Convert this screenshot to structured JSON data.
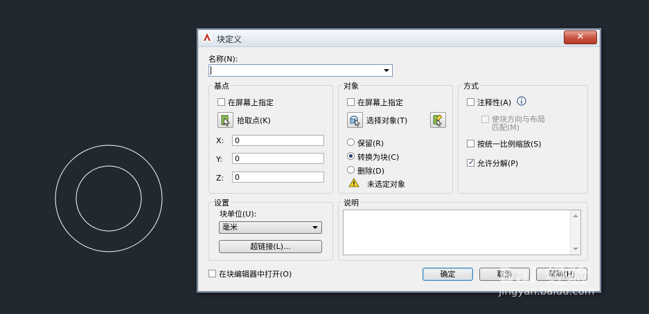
{
  "drawing": {
    "stroke_color": "#ffffff",
    "background": "#212830"
  },
  "dialog": {
    "title": "块定义",
    "close_label": "✕",
    "name_label": "名称(N):",
    "name_value": "",
    "basepoint": {
      "group_title": "基点",
      "specify_on_screen": "在屏幕上指定",
      "pick_point": "拾取点(K)",
      "x_label": "X:",
      "x_value": "0",
      "y_label": "Y:",
      "y_value": "0",
      "z_label": "Z:",
      "z_value": "0"
    },
    "objects": {
      "group_title": "对象",
      "specify_on_screen": "在屏幕上指定",
      "select_objects": "选择对象(T)",
      "retain": "保留(R)",
      "convert_to_block": "转换为块(C)",
      "delete": "删除(D)",
      "selected_convert": true,
      "status": "未选定对象"
    },
    "behavior": {
      "group_title": "方式",
      "annotative": "注释性(A)",
      "match_orientation_line1": "使块方向与布局",
      "match_orientation_line2": "匹配(M)",
      "scale_uniformly": "按统一比例缩放(S)",
      "allow_exploding": "允许分解(P)",
      "allow_exploding_checked": true
    },
    "settings": {
      "group_title": "设置",
      "block_unit_label": "块单位(U):",
      "block_unit_value": "毫米",
      "hyperlink_label": "超链接(L)..."
    },
    "description": {
      "group_title": "说明",
      "value": ""
    },
    "open_in_editor": "在块编辑器中打开(O)",
    "buttons": {
      "ok": "确定",
      "cancel": "取消",
      "help": "帮助(H)"
    }
  },
  "watermark": {
    "brand": "Bai 经验",
    "url": "jingyan.baidu.com"
  }
}
